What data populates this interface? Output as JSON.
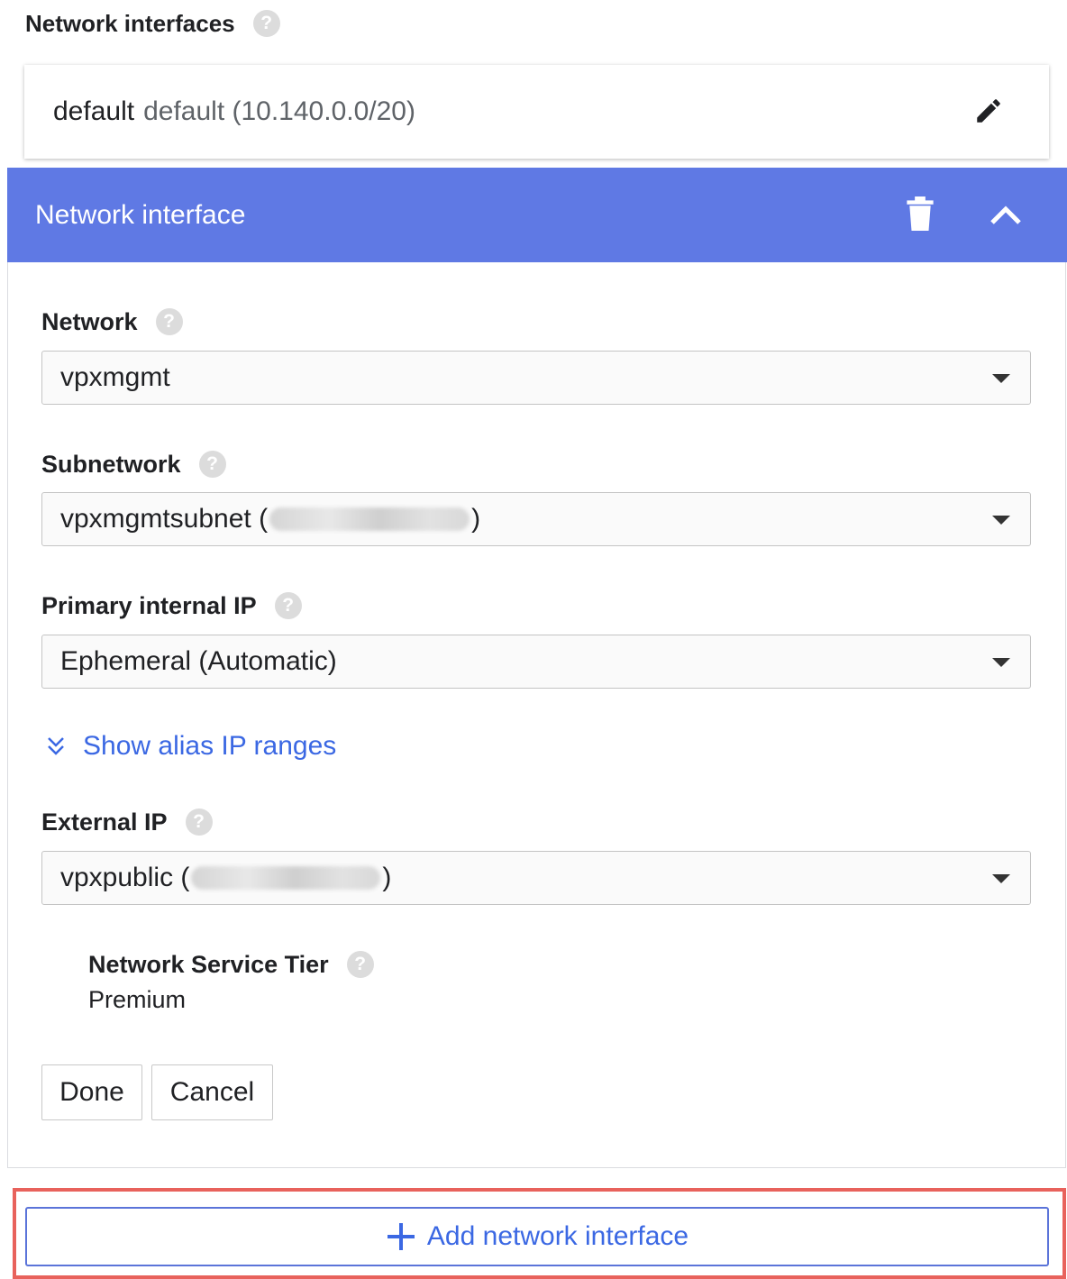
{
  "section": {
    "title": "Network interfaces"
  },
  "summary": {
    "network_name": "default",
    "network_detail": "default (10.140.0.0/20)"
  },
  "panel": {
    "title": "Network interface"
  },
  "fields": {
    "network": {
      "label": "Network",
      "value": "vpxmgmt"
    },
    "subnetwork": {
      "label": "Subnetwork",
      "value_prefix": "vpxmgmtsubnet (",
      "value_suffix": ")"
    },
    "primary_ip": {
      "label": "Primary internal IP",
      "value": "Ephemeral (Automatic)"
    },
    "external_ip": {
      "label": "External IP",
      "value_prefix": "vpxpublic (",
      "value_suffix": ")"
    }
  },
  "alias_link": {
    "label": "Show alias IP ranges"
  },
  "service_tier": {
    "label": "Network Service Tier",
    "value": "Premium"
  },
  "buttons": {
    "done": "Done",
    "cancel": "Cancel"
  },
  "add_button": {
    "label": "Add network interface"
  },
  "colors": {
    "header_bg": "#5f79e4",
    "link": "#3b68e3",
    "highlight_border": "#e8625c"
  },
  "icons": [
    "help-icon",
    "edit-icon",
    "delete-icon",
    "chevron-up-icon",
    "dropdown-caret-icon",
    "double-chevron-down-icon",
    "plus-icon"
  ]
}
